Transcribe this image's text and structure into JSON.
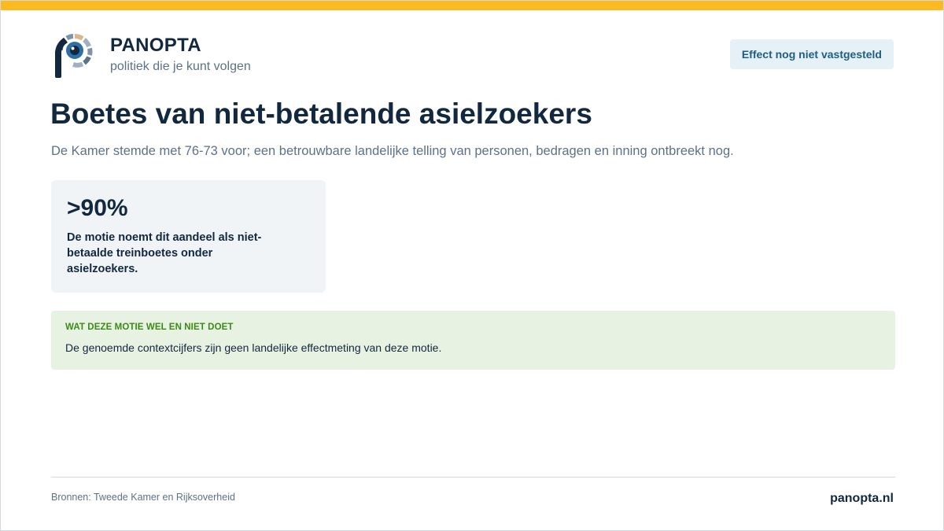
{
  "colors": {
    "accent_bar": "#fbba1f",
    "navy": "#12283f",
    "muted": "#5d7287",
    "badge_bg": "#e5f0f7",
    "badge_text": "#1e5e84",
    "card_bg": "#f1f4f7",
    "notice_bg": "#e8f2e2",
    "notice_heading": "#3a8a18"
  },
  "brand": {
    "logo_icon": "panopta-eye-p-logo",
    "name": "PANOPTA",
    "tagline": "politiek die je kunt volgen"
  },
  "status_badge": {
    "label": "Effect nog niet vastgesteld"
  },
  "main": {
    "title": "Boetes van niet-betalende asielzoekers",
    "subtitle": "De Kamer stemde met 76-73 voor; een betrouwbare landelijke telling van personen, bedragen en inning ontbreekt nog.",
    "stat": {
      "value": ">90%",
      "description": "De motie noemt dit aandeel als niet-betaalde treinboetes onder asielzoekers."
    },
    "notice": {
      "heading": "WAT DEZE MOTIE WEL EN NIET DOET",
      "text": "De genoemde contextcijfers zijn geen landelijke effectmeting van deze motie."
    }
  },
  "footer": {
    "sources": "Bronnen: Tweede Kamer en Rijksoverheid",
    "site": "panopta.nl"
  }
}
